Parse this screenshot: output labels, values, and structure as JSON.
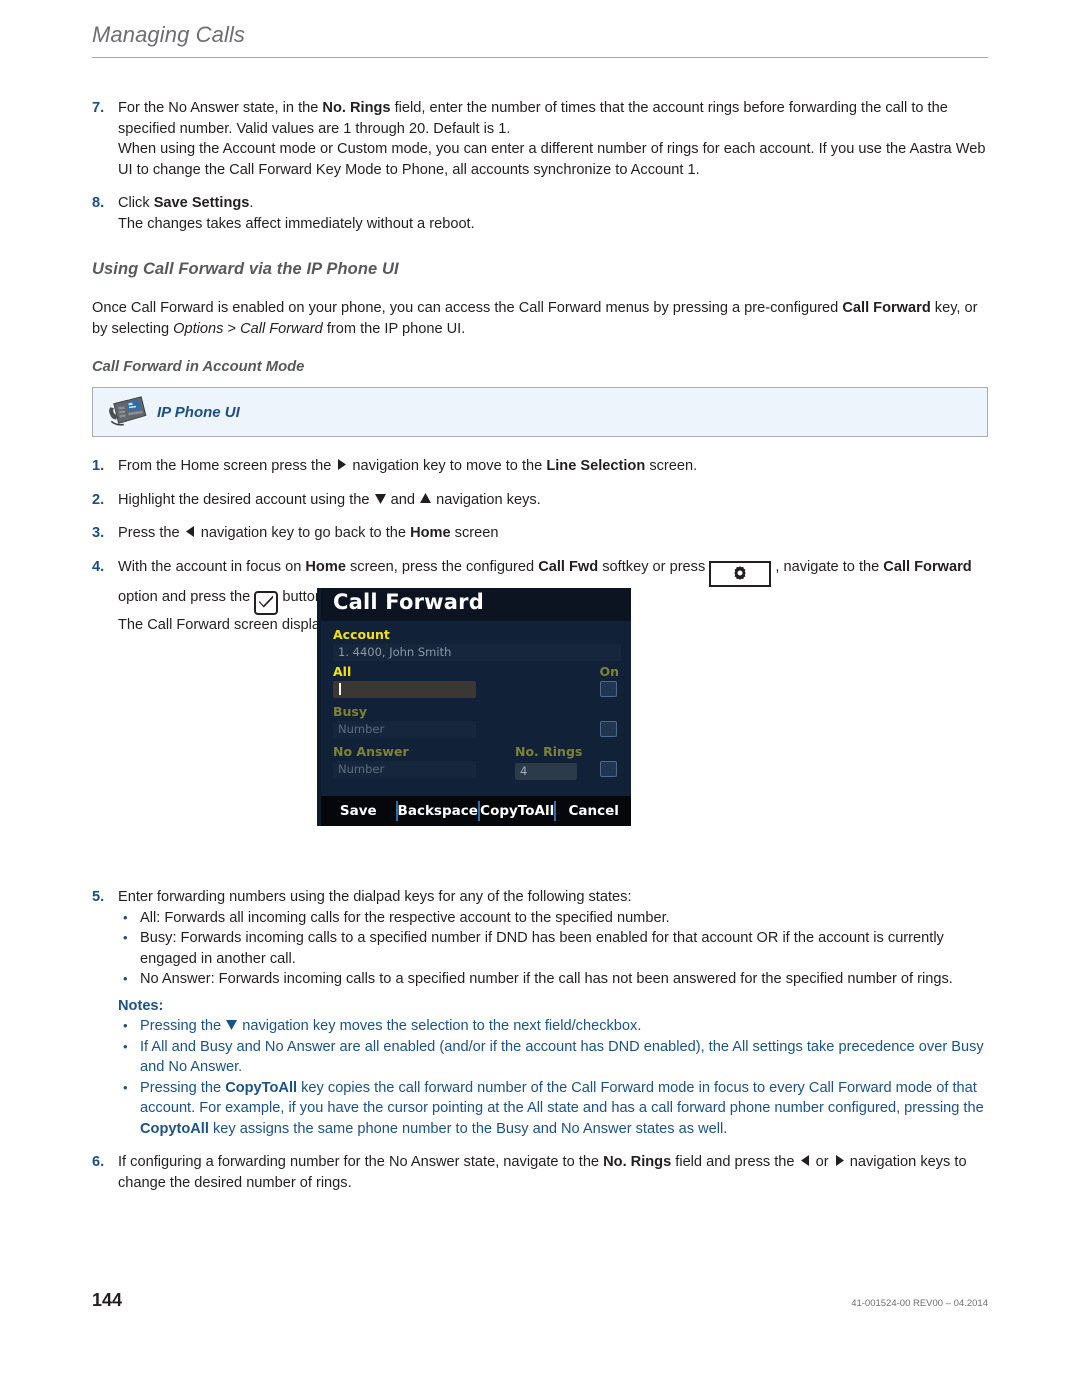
{
  "header": {
    "title": "Managing Calls"
  },
  "steps_top": [
    {
      "num": "7.",
      "lines": [
        "For the No Answer state, in the <b>No. Rings</b> field, enter the number of times that the account rings before forwarding the call to the specified number. Valid values are 1 through 20. Default is 1.",
        "When using the Account mode or Custom mode, you can enter a different number of rings for each account. If you use the Aastra Web UI to change the Call Forward Key Mode to Phone, all accounts synchronize to Account 1."
      ]
    },
    {
      "num": "8.",
      "lines": [
        "Click <b>Save Settings</b>.",
        "The changes takes affect immediately without a reboot."
      ]
    }
  ],
  "section": {
    "title": "Using Call Forward via the IP Phone UI",
    "paragraph": "Once Call Forward is enabled on your phone, you can access the Call Forward menus by pressing a pre-configured <b>Call Forward</b> key, or by selecting <i>Options</i> &gt; <i>Call Forward</i> from the IP phone UI.",
    "subtitle": "Call Forward in Account Mode"
  },
  "callout": {
    "label": "IP Phone UI",
    "icon": "desk-phone-icon"
  },
  "steps_ui": [
    {
      "num": "1.",
      "html": "From the Home screen press the <span class=\"arrow-right\"></span> navigation key to move to the <b>Line Selection</b> screen."
    },
    {
      "num": "2.",
      "html": "Highlight the desired account using the <span class=\"arrow-down\"></span> and <span class=\"arrow-up\"></span> navigation keys."
    },
    {
      "num": "3.",
      "html": "Press the <span class=\"arrow-left\"></span> navigation key to go back to the <b>Home</b> screen"
    },
    {
      "num": "4.",
      "html": "With the account in focus on <b>Home</b> screen, press the configured <b>Call Fwd</b> softkey or press <span class=\"gear-key\"></span> , navigate to the <b>Call Forward</b> option and press the <span class=\"check-key\"></span> button or <b>Select</b> softkey.<br>The Call Forward screen displays for the account you selected."
    }
  ],
  "phone_screen": {
    "title": "Call Forward",
    "account_label": "Account",
    "account_value": "1. 4400, John Smith",
    "all_label": "All",
    "all_value": "",
    "on_label": "On",
    "busy_label": "Busy",
    "busy_placeholder": "Number",
    "no_answer_label": "No Answer",
    "no_answer_placeholder": "Number",
    "no_rings_label": "No. Rings",
    "no_rings_value": "4",
    "softkeys": [
      "Save",
      "Backspace",
      "CopyToAll",
      "Cancel"
    ]
  },
  "step5": {
    "num": "5.",
    "intro": "Enter forwarding numbers using the dialpad keys for any of the following states:",
    "bullets": [
      "All: Forwards all incoming calls for the respective account to the specified number.",
      "Busy: Forwards incoming calls to a specified number if DND has been enabled for that account OR if the account is currently engaged in another call.",
      "No Answer: Forwards incoming calls to a specified number if the call has not been answered for the specified number of rings."
    ]
  },
  "notes": {
    "heading": "Notes:",
    "bullets": [
      "Pressing the <span class=\"arrow-down-blue\"></span> navigation key moves the selection to the next field/checkbox.",
      "If All and Busy and No Answer are all enabled (and/or if the account has DND enabled), the All settings take precedence over Busy and No Answer.",
      "Pressing the <b>CopyToAll</b> key copies the call forward number of the Call Forward mode in focus to every Call Forward mode of that account. For example, if you have the cursor pointing at the All state and has a call forward phone number configured, pressing the <b>CopytoAll</b> key assigns the same phone number to the Busy and No Answer states as well."
    ]
  },
  "step6": {
    "num": "6.",
    "html": "If configuring a forwarding number for the No Answer state, navigate to the <b>No. Rings</b> field and press the <span class=\"arrow-left\"></span> or <span class=\"arrow-right\"></span> navigation keys to change the desired number of rings."
  },
  "footer": {
    "page_number": "144",
    "revision": "41-001524-00 REV00 – 04.2014"
  },
  "colors": {
    "accent_blue": "#1b4e85",
    "note_blue": "#1b5288",
    "heading_gray": "#58595b",
    "callout_bg": "#eef4fb",
    "phone_bg": "#102138",
    "phone_yellow": "#f2e215",
    "phone_olive": "#7e8333"
  }
}
